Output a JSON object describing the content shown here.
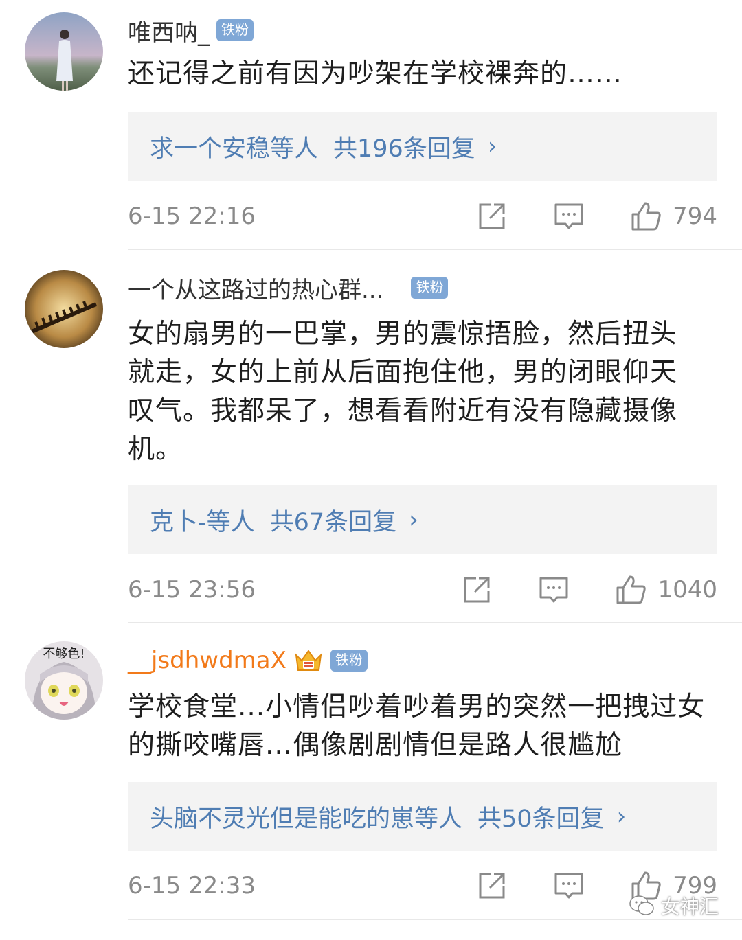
{
  "comments": [
    {
      "username": "唯西呐_",
      "badge": "铁粉",
      "text": "还记得之前有因为吵架在学校裸奔的……",
      "reply_who": "求一个安稳等人",
      "reply_count": "共196条回复",
      "time": "6-15 22:16",
      "likes": "794"
    },
    {
      "username": "一个从这路过的热心群...",
      "badge": "铁粉",
      "text": "女的扇男的一巴掌，男的震惊捂脸，然后扭头就走，女的上前从后面抱住他，男的闭眼仰天叹气。我都呆了，想看看附近有没有隐藏摄像机。",
      "reply_who": "克卜-等人",
      "reply_count": "共67条回复",
      "time": "6-15 23:56",
      "likes": "1040"
    },
    {
      "username": "__jsdhwdmaX",
      "badge": "铁粉",
      "avatar_text": "不够色!",
      "text": "学校食堂...小情侣吵着吵着男的突然一把拽过女的撕咬嘴唇...偶像剧剧情但是路人很尴尬",
      "reply_who": "头脑不灵光但是能吃的崽等人",
      "reply_count": "共50条回复",
      "time": "6-15 22:33",
      "likes": "799"
    }
  ],
  "reply_chevron": "›",
  "watermark": "女神汇",
  "colors": {
    "link_blue": "#4f7db3",
    "badge_blue": "#7fa7d6",
    "vip_orange": "#f27a1a",
    "meta_gray": "#8a8a8a",
    "reply_bg": "#f3f3f3"
  },
  "icons": [
    "share-icon",
    "comment-icon",
    "thumbs-up-icon",
    "crown-icon",
    "wechat-icon"
  ]
}
